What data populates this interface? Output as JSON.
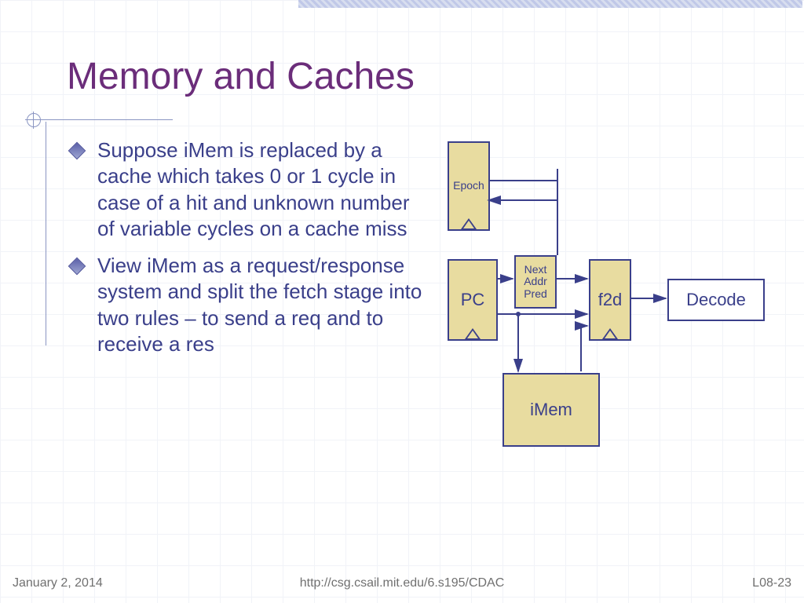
{
  "title": "Memory and Caches",
  "bullets": [
    "Suppose iMem is replaced by a cache which takes 0 or 1 cycle in case of a hit and unknown number of variable cycles on a cache miss",
    "View iMem as a request/response system and split the fetch stage into two rules – to send a req and to receive a res"
  ],
  "diagram": {
    "epoch": "Epoch",
    "pc": "PC",
    "nap1": "Next",
    "nap2": "Addr",
    "nap3": "Pred",
    "f2d": "f2d",
    "decode": "Decode",
    "imem": "iMem"
  },
  "footer": {
    "date": "January 2, 2014",
    "url": "http://csg.csail.mit.edu/6.s195/CDAC",
    "page": "L08-23"
  }
}
